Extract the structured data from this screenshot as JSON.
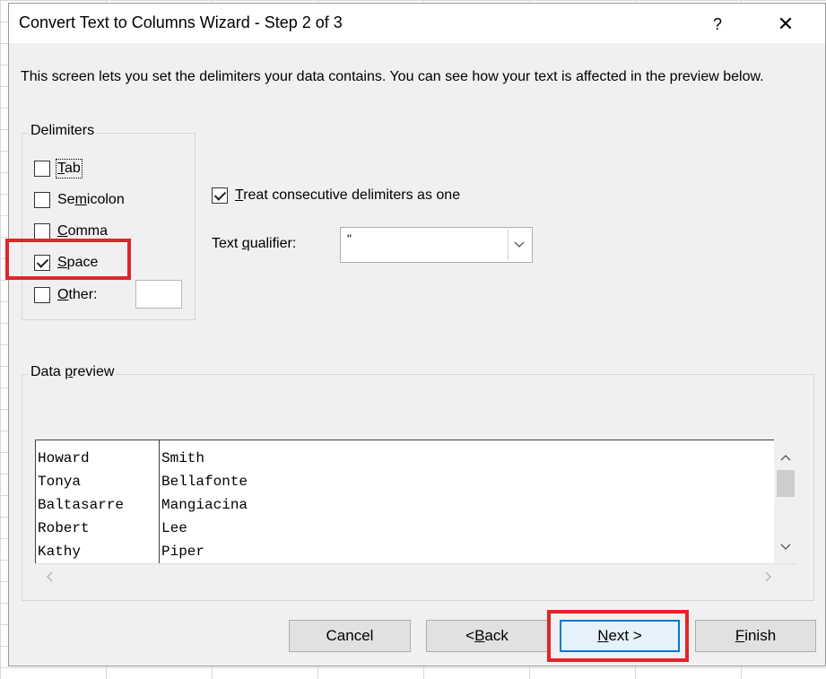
{
  "dialog": {
    "title": "Convert Text to Columns Wizard - Step 2 of 3",
    "help_label": "?",
    "close_label": "✕",
    "intro_text": "This screen lets you set the delimiters your data contains.  You can see how your text is affected in the preview below."
  },
  "delimiters": {
    "group_label": "Delimiters",
    "options": [
      {
        "label": "Tab",
        "checked": false
      },
      {
        "label": "Semicolon",
        "checked": false
      },
      {
        "label": "Comma",
        "checked": false
      },
      {
        "label": "Space",
        "checked": true
      },
      {
        "label": "Other:",
        "checked": false
      }
    ],
    "other_value": ""
  },
  "consecutive": {
    "label": "Treat consecutive delimiters as one",
    "checked": true
  },
  "qualifier": {
    "label": "Text qualifier:",
    "value": "\""
  },
  "preview": {
    "group_label": "Data preview",
    "rows": [
      [
        "Howard",
        "Smith"
      ],
      [
        "Tonya",
        "Bellafonte"
      ],
      [
        "Baltasarre",
        "Mangiacina"
      ],
      [
        "Robert",
        "Lee"
      ],
      [
        "Kathy",
        "Piper"
      ]
    ]
  },
  "buttons": {
    "cancel": "Cancel",
    "back": "< Back",
    "next": "Next >",
    "finish": "Finish"
  },
  "highlight_color": "#e0252c",
  "accent_color": "#0078d7",
  "icons": {
    "scroll_up": "▲",
    "scroll_down": "▼",
    "scroll_left": "<",
    "scroll_right": ">",
    "dropdown": "﹀"
  }
}
